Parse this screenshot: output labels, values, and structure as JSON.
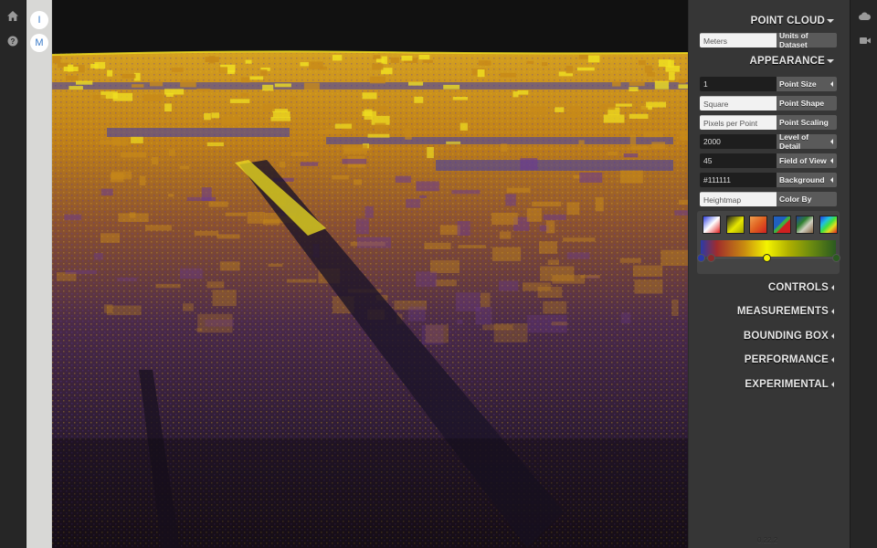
{
  "left_nav": {
    "icons": [
      {
        "name": "home-icon",
        "glyph": "home"
      },
      {
        "name": "help-icon",
        "glyph": "?"
      }
    ]
  },
  "tools": {
    "inspect_label": "I",
    "measure_label": "M"
  },
  "panel": {
    "point_cloud": {
      "title": "POINT CLOUD",
      "units": {
        "value": "Meters",
        "label": "Units of Dataset"
      }
    },
    "appearance": {
      "title": "APPEARANCE",
      "rows": [
        {
          "value": "1",
          "label": "Point Size",
          "has_arrow": true,
          "style": "dark"
        },
        {
          "value": "Square",
          "label": "Point Shape",
          "has_arrow": false,
          "style": "light"
        },
        {
          "value": "Pixels per Point",
          "label": "Point Scaling",
          "has_arrow": false,
          "style": "light"
        },
        {
          "value": "2000",
          "label": "Level of Detail",
          "has_arrow": true,
          "style": "dark"
        },
        {
          "value": "45",
          "label": "Field of View",
          "has_arrow": true,
          "style": "dark"
        },
        {
          "value": "#111111",
          "label": "Background",
          "has_arrow": true,
          "style": "dark"
        },
        {
          "value": "Heightmap",
          "label": "Color By",
          "has_arrow": false,
          "style": "light"
        }
      ],
      "gradient_presets": [
        "white-blue-red",
        "yellow-dark",
        "orange-red",
        "rainbow-stripe",
        "green-brown",
        "spectrum"
      ],
      "gradient_stops": [
        {
          "color": "#2a3aa8",
          "position": 0.0
        },
        {
          "color": "#8a2a2a",
          "position": 0.08
        },
        {
          "color": "#f4f400",
          "position": 0.49
        },
        {
          "color": "#2a5a20",
          "position": 1.0
        }
      ]
    },
    "collapsed_sections": [
      "CONTROLS",
      "MEASUREMENTS",
      "BOUNDING BOX",
      "PERFORMANCE",
      "EXPERIMENTAL"
    ],
    "version": "0.22.2"
  },
  "right_nav": {
    "icons": [
      {
        "name": "cloud-icon"
      },
      {
        "name": "camera-icon"
      }
    ]
  },
  "viewport": {
    "background": "#111111",
    "colors": {
      "high": "#f0e020",
      "mid": "#c88a18",
      "low": "#6a3a90",
      "ground": "#3a2a60"
    }
  }
}
